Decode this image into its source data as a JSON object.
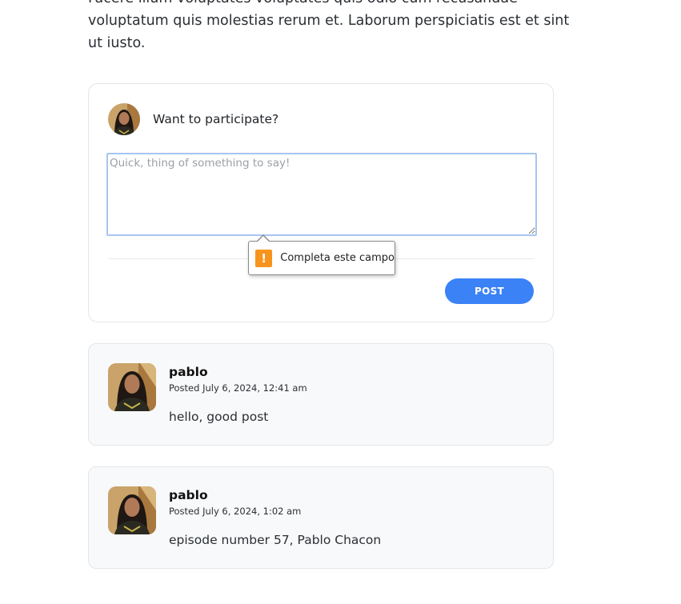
{
  "article": {
    "line1": "Facere illum voluptates voluptates quis odio cum recusandae",
    "line2": "voluptatum quis molestias rerum et. Laborum perspiciatis est et sint",
    "line3": "ut iusto."
  },
  "composer": {
    "prompt": "Want to participate?",
    "placeholder": "Quick, thing of something to say!",
    "value": "",
    "post_label": "POST"
  },
  "validation": {
    "message": "Completa este campo",
    "icon": "warning-icon"
  },
  "comments": [
    {
      "author": "pablo",
      "date": "Posted July 6, 2024, 12:41 am",
      "body": "hello, good post"
    },
    {
      "author": "pablo",
      "date": "Posted July 6, 2024, 1:02 am",
      "body": "episode number 57, Pablo Chacon"
    }
  ],
  "colors": {
    "accent": "#3b82f6",
    "warning": "#f7941d",
    "card_bg": "#f8f9fa"
  }
}
